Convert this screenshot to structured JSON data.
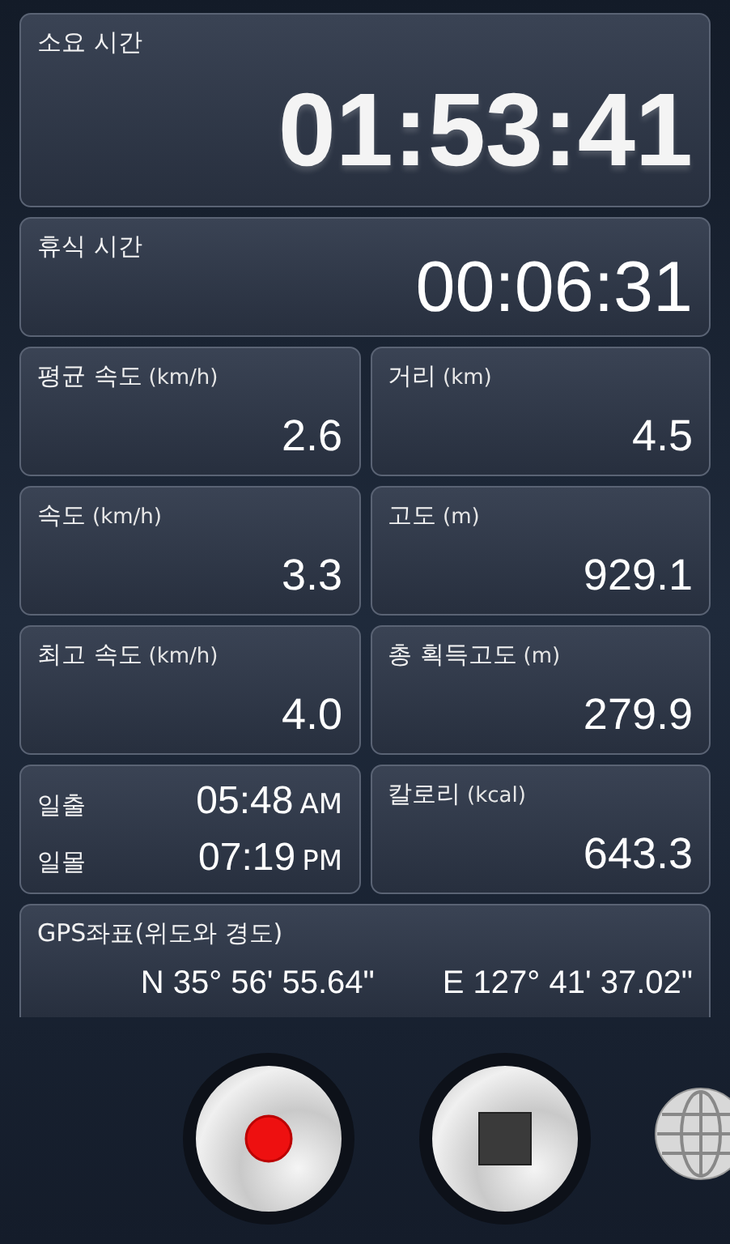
{
  "elapsed": {
    "label": "소요 시간",
    "value": "01:53:41"
  },
  "rest": {
    "label": "휴식 시간",
    "value": "00:06:31"
  },
  "stats": [
    {
      "kind": "stat",
      "label": "평균 속도",
      "unit": "(km/h)",
      "value": "2.6"
    },
    {
      "kind": "stat",
      "label": "거리",
      "unit": "(km)",
      "value": "4.5"
    },
    {
      "kind": "stat",
      "label": "속도",
      "unit": "(km/h)",
      "value": "3.3"
    },
    {
      "kind": "stat",
      "label": "고도",
      "unit": "(m)",
      "value": "929.1"
    },
    {
      "kind": "stat",
      "label": "최고 속도",
      "unit": "(km/h)",
      "value": "4.0"
    },
    {
      "kind": "stat",
      "label": "총 획득고도",
      "unit": "(m)",
      "value": "279.9"
    },
    {
      "kind": "sun",
      "rows": [
        {
          "label": "일출",
          "time": "05:48",
          "ampm": "AM"
        },
        {
          "label": "일몰",
          "time": "07:19",
          "ampm": "PM"
        }
      ]
    },
    {
      "kind": "stat",
      "label": "칼로리",
      "unit": "(kcal)",
      "value": "643.3"
    }
  ],
  "gps": {
    "label": "GPS좌표(위도와 경도)",
    "latitude": "N 35° 56' 55.64\"",
    "longitude": "E 127° 41' 37.02\""
  }
}
